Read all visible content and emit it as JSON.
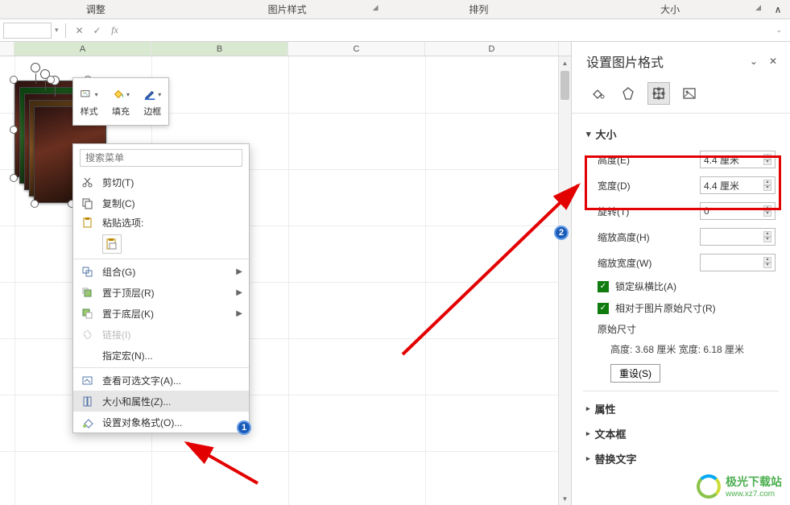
{
  "ribbon": {
    "tabs": [
      "调整",
      "图片样式",
      "排列",
      "大小"
    ]
  },
  "formula_bar": {
    "name_box_value": "",
    "cancel_glyph": "✕",
    "confirm_glyph": "✓",
    "fx_label": "fx"
  },
  "columns": [
    "A",
    "B",
    "C",
    "D"
  ],
  "mini_toolbar": {
    "items": [
      {
        "label": "样式"
      },
      {
        "label": "填充"
      },
      {
        "label": "边框"
      }
    ]
  },
  "context_menu": {
    "search_placeholder": "搜索菜单",
    "items": {
      "cut": "剪切(T)",
      "copy": "复制(C)",
      "paste_section": "粘贴选项:",
      "group": "组合(G)",
      "bring_front": "置于顶层(R)",
      "send_back": "置于底层(K)",
      "link": "链接(I)",
      "assign_macro": "指定宏(N)...",
      "alt_text": "查看可选文字(A)...",
      "size_props": "大小和属性(Z)...",
      "format_object": "设置对象格式(O)..."
    }
  },
  "pane": {
    "title": "设置图片格式",
    "sections": {
      "size": {
        "header": "大小",
        "height_label": "高度(E)",
        "height_value": "4.4 厘米",
        "width_label": "宽度(D)",
        "width_value": "4.4 厘米",
        "rotation_label": "旋转(T)",
        "rotation_value": "0°",
        "scale_h_label": "缩放高度(H)",
        "scale_h_value": "",
        "scale_w_label": "缩放宽度(W)",
        "scale_w_value": "",
        "lock_ratio": "锁定纵横比(A)",
        "relative_orig": "相对于图片原始尺寸(R)",
        "original_label": "原始尺寸",
        "original_value": "高度: 3.68 厘米  宽度: 6.18 厘米",
        "reset_btn": "重设(S)"
      },
      "properties": "属性",
      "textbox": "文本框",
      "alt_text": "替换文字"
    }
  },
  "annotations": {
    "num1": "1",
    "num2": "2"
  },
  "watermark": {
    "cn": "极光下载站",
    "en": "www.xz7.com"
  }
}
